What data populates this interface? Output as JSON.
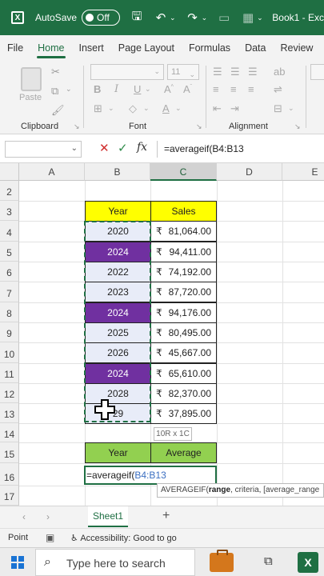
{
  "titlebar": {
    "autosave_label": "AutoSave",
    "autosave_state": "Off",
    "doc_title": "Book1 - Exc"
  },
  "tabs": [
    "File",
    "Home",
    "Insert",
    "Page Layout",
    "Formulas",
    "Data",
    "Review"
  ],
  "active_tab": "Home",
  "ribbon": {
    "paste_label": "Paste",
    "clipboard_label": "Clipboard",
    "font_label": "Font",
    "font_size": "11",
    "alignment_label": "Alignment"
  },
  "formula_bar": {
    "fx_label": "fx",
    "formula": "=averageif(B4:B13"
  },
  "columns": [
    "A",
    "B",
    "C",
    "D",
    "E"
  ],
  "rows": [
    "2",
    "3",
    "4",
    "5",
    "6",
    "7",
    "8",
    "9",
    "10",
    "11",
    "12",
    "13",
    "14",
    "15",
    "16",
    "17"
  ],
  "table": {
    "year_header": "Year",
    "sales_header": "Sales",
    "currency": "₹",
    "rows": [
      {
        "year": "2020",
        "sales": "81,064.00",
        "hl": false
      },
      {
        "year": "2024",
        "sales": "94,411.00",
        "hl": true
      },
      {
        "year": "2022",
        "sales": "74,192.00",
        "hl": false
      },
      {
        "year": "2023",
        "sales": "87,720.00",
        "hl": false
      },
      {
        "year": "2024",
        "sales": "94,176.00",
        "hl": true
      },
      {
        "year": "2025",
        "sales": "80,495.00",
        "hl": false
      },
      {
        "year": "2026",
        "sales": "45,667.00",
        "hl": false
      },
      {
        "year": "2024",
        "sales": "65,610.00",
        "hl": true
      },
      {
        "year": "2028",
        "sales": "82,370.00",
        "hl": false
      },
      {
        "year": "29",
        "sales": "37,895.00",
        "hl": false
      }
    ]
  },
  "size_tip": "10R x 1C",
  "summary": {
    "year_header": "Year",
    "average_header": "Average"
  },
  "edit_cell": {
    "prefix": "=averageif(",
    "ref": "B4:B13"
  },
  "fn_tip": {
    "name": "AVERAGEIF(",
    "arg1": "range",
    "rest": ", criteria, [average_range"
  },
  "sheet_tab": "Sheet1",
  "status": {
    "mode": "Point",
    "accessibility": "Accessibility: Good to go"
  },
  "taskbar": {
    "search_placeholder": "Type here to search"
  },
  "colors": {
    "excel_green": "#1f6f43",
    "year_header_fill": "#ffff00",
    "summary_header_fill": "#92d050",
    "highlight_fill": "#7030a0"
  }
}
